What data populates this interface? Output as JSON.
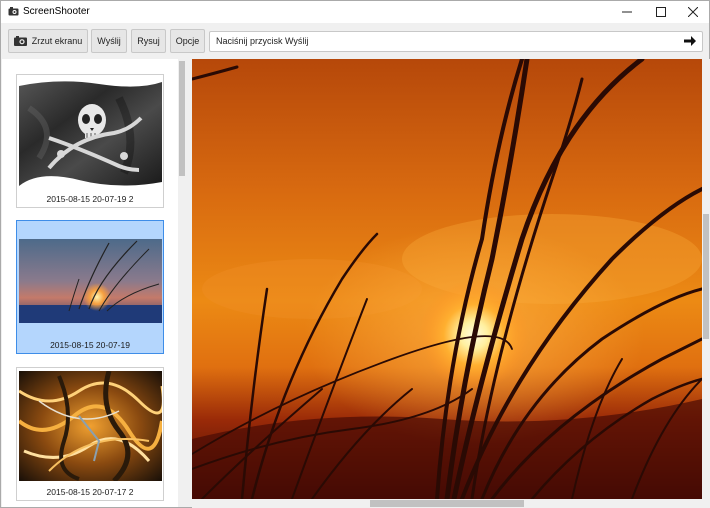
{
  "window": {
    "title": "ScreenShooter",
    "icons": {
      "app": "camera-icon",
      "minimize": "minimize-icon",
      "maximize": "maximize-icon",
      "close": "close-icon"
    }
  },
  "toolbar": {
    "screenshot_label": "Zrzut ekranu",
    "screenshot_icon": "camera-icon",
    "send_label": "Wyślij",
    "draw_label": "Rysuj",
    "options_label": "Opcje",
    "status_text": "Naciśnij przycisk Wyślij",
    "status_icon": "arrow-right-icon"
  },
  "thumbnails": [
    {
      "caption": "2015-08-15 20-07-19 2",
      "image": "pirate-flag",
      "selected": false
    },
    {
      "caption": "2015-08-15 20-07-19",
      "image": "sunset-grass",
      "selected": true
    },
    {
      "caption": "2015-08-15 20-07-17 2",
      "image": "abstract-fire",
      "selected": false
    }
  ],
  "viewer": {
    "image": "sunset-grass"
  },
  "colors": {
    "selection_bg": "#b4d6fd",
    "selection_border": "#3e8de8",
    "sunset_orange": "#e8770e",
    "sky_dark": "#b8460a"
  }
}
